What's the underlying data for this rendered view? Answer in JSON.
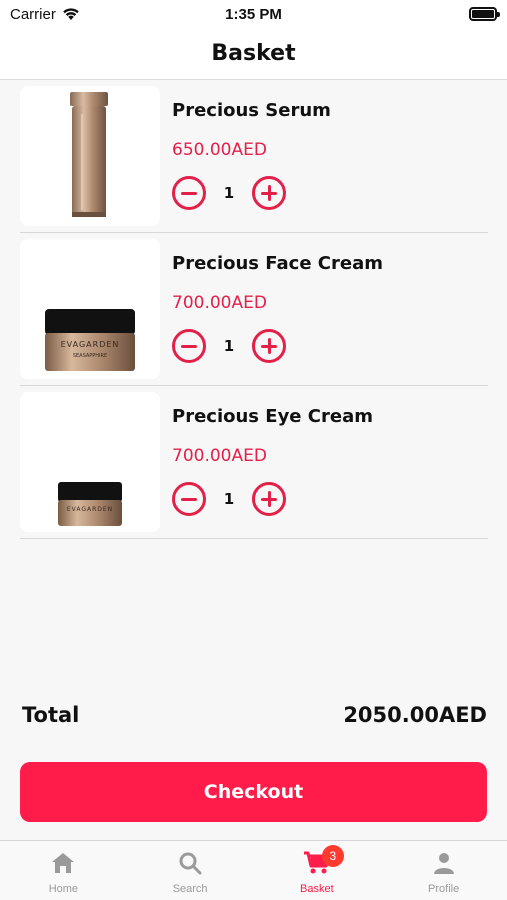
{
  "status_bar": {
    "carrier": "Carrier",
    "time": "1:35 PM"
  },
  "nav": {
    "title": "Basket"
  },
  "items": [
    {
      "name": "Precious Serum",
      "price": "650.00AED",
      "quantity": "1"
    },
    {
      "name": "Precious Face Cream",
      "price": "700.00AED",
      "quantity": "1"
    },
    {
      "name": "Precious Eye Cream",
      "price": "700.00AED",
      "quantity": "1"
    }
  ],
  "product_brand_text": "EVAGARDEN",
  "product_line_text": "SEASAPPHIRE",
  "summary": {
    "total_label": "Total",
    "total_value": "2050.00AED"
  },
  "checkout": {
    "label": "Checkout"
  },
  "tabs": [
    {
      "label": "Home",
      "icon": "home-icon"
    },
    {
      "label": "Search",
      "icon": "search-icon"
    },
    {
      "label": "Basket",
      "icon": "cart-icon",
      "badge": "3",
      "active": true
    },
    {
      "label": "Profile",
      "icon": "person-icon"
    }
  ],
  "colors": {
    "accent": "#ff1c4a",
    "price": "#e3204a",
    "inactive_tab": "#9a9a9a"
  }
}
